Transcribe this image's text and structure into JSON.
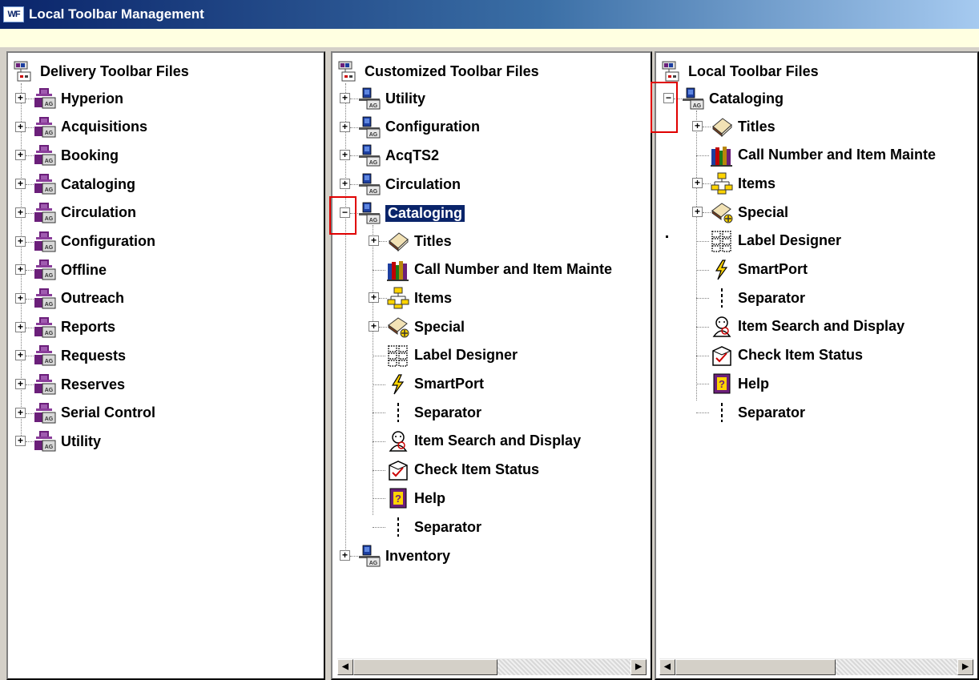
{
  "window": {
    "title": "Local Toolbar Management",
    "app_badge": "WF"
  },
  "panes": {
    "delivery": {
      "header": "Delivery Toolbar Files",
      "items": [
        "Hyperion",
        "Acquisitions",
        "Booking",
        "Cataloging",
        "Circulation",
        "Configuration",
        "Offline",
        "Outreach",
        "Reports",
        "Requests",
        "Reserves",
        "Serial Control",
        "Utility"
      ]
    },
    "customized": {
      "header": "Customized Toolbar Files",
      "top_items": [
        "Utility",
        "Configuration",
        "AcqTS2",
        "Circulation"
      ],
      "expanded_item": "Cataloging",
      "children": [
        {
          "label": "Titles",
          "icon": "book-icon",
          "expander": "+"
        },
        {
          "label": "Call Number and Item Mainte",
          "icon": "books-shelf-icon",
          "expander": ""
        },
        {
          "label": "Items",
          "icon": "hierarchy-icon",
          "expander": "+"
        },
        {
          "label": "Special",
          "icon": "special-book-icon",
          "expander": "+"
        },
        {
          "label": "Label Designer",
          "icon": "label-grid-icon",
          "expander": ""
        },
        {
          "label": "SmartPort",
          "icon": "lightning-icon",
          "expander": ""
        },
        {
          "label": "Separator",
          "icon": "separator-icon",
          "expander": ""
        },
        {
          "label": "Item Search and Display",
          "icon": "search-person-icon",
          "expander": ""
        },
        {
          "label": "Check Item Status",
          "icon": "check-status-icon",
          "expander": ""
        },
        {
          "label": "Help",
          "icon": "help-icon",
          "expander": ""
        },
        {
          "label": "Separator",
          "icon": "separator-icon",
          "expander": ""
        }
      ],
      "after_items": [
        "Inventory"
      ]
    },
    "local": {
      "header": "Local Toolbar Files",
      "expanded_item": "Cataloging",
      "children": [
        {
          "label": "Titles",
          "icon": "book-icon",
          "expander": "+"
        },
        {
          "label": "Call Number and Item Mainte",
          "icon": "books-shelf-icon",
          "expander": ""
        },
        {
          "label": "Items",
          "icon": "hierarchy-icon",
          "expander": "+"
        },
        {
          "label": "Special",
          "icon": "special-book-icon",
          "expander": "+"
        },
        {
          "label": "Label Designer",
          "icon": "label-grid-icon",
          "expander": ""
        },
        {
          "label": "SmartPort",
          "icon": "lightning-icon",
          "expander": ""
        },
        {
          "label": "Separator",
          "icon": "separator-icon",
          "expander": ""
        },
        {
          "label": "Item Search and Display",
          "icon": "search-person-icon",
          "expander": ""
        },
        {
          "label": "Check Item Status",
          "icon": "check-status-icon",
          "expander": ""
        },
        {
          "label": "Help",
          "icon": "help-icon",
          "expander": ""
        },
        {
          "label": "Separator",
          "icon": "separator-icon",
          "expander": ""
        }
      ]
    }
  },
  "colors": {
    "selection": "#0a246a",
    "highlight": "#e00000",
    "purple_icon": "#6b1f7a"
  }
}
